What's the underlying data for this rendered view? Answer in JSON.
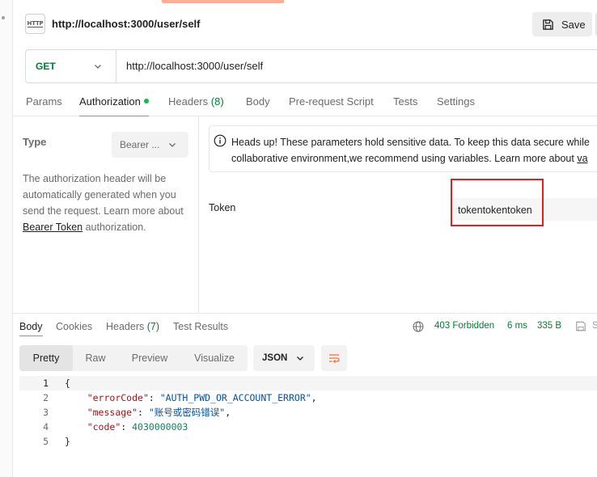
{
  "header": {
    "icon_text": "HTTP",
    "title": "http://localhost:3000/user/self",
    "save_label": "Save"
  },
  "request": {
    "method": "GET",
    "url": "http://localhost:3000/user/self"
  },
  "request_tabs": {
    "params": "Params",
    "authorization": "Authorization",
    "headers": "Headers",
    "headers_count": "(8)",
    "body": "Body",
    "prerequest": "Pre-request Script",
    "tests": "Tests",
    "settings": "Settings"
  },
  "auth": {
    "type_label": "Type",
    "type_value": "Bearer ...",
    "desc_before": "The authorization header will be automatically generated when you send the request. Learn more about ",
    "desc_link": "Bearer Token",
    "desc_after": " authorization.",
    "notice_line1": "Heads up! These parameters hold sensitive data. To keep this data secure while",
    "notice_line2_before": "collaborative environment,we recommend using variables. Learn more about ",
    "notice_link": "va",
    "token_label": "Token",
    "token_value": "tokentokentoken"
  },
  "response_tabs": {
    "body": "Body",
    "cookies": "Cookies",
    "headers": "Headers",
    "headers_count": "(7)",
    "test_results": "Test Results"
  },
  "response_meta": {
    "status": "403 Forbidden",
    "time": "6 ms",
    "size": "335 B",
    "edge_text": "S"
  },
  "view": {
    "pretty": "Pretty",
    "raw": "Raw",
    "preview": "Preview",
    "visualize": "Visualize",
    "format": "JSON"
  },
  "code": {
    "line_numbers": [
      "1",
      "2",
      "3",
      "4",
      "5"
    ],
    "open_brace": "{",
    "close_brace": "}",
    "key1": "\"errorCode\"",
    "val1": "\"AUTH_PWD_OR_ACCOUNT_ERROR\"",
    "key2": "\"message\"",
    "val2": "\"账号或密码错误\"",
    "key3": "\"code\"",
    "val3": "4030000003"
  },
  "colors": {
    "accent": "#ff6c37",
    "method_get": "#007f31",
    "status": "#007f31",
    "highlight": "#e02020"
  }
}
